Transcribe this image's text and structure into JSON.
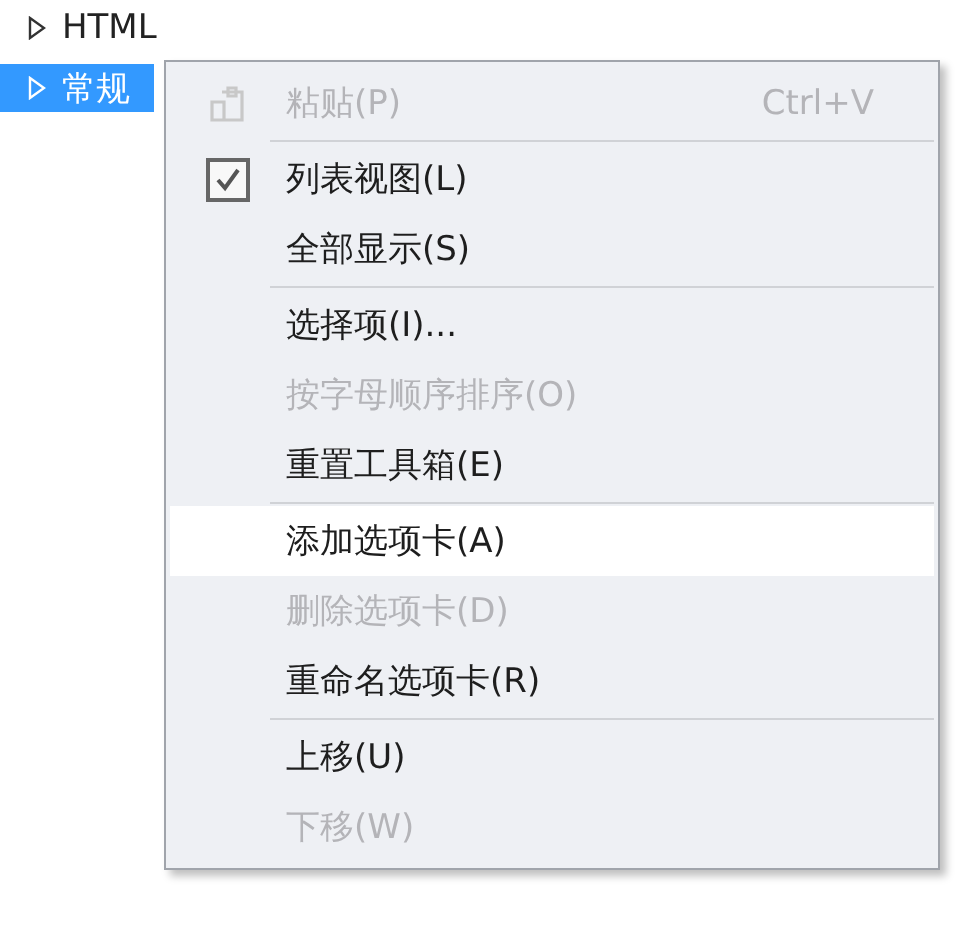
{
  "tree": [
    {
      "label": "HTML",
      "selected": false
    },
    {
      "label": "常规",
      "selected": true
    }
  ],
  "menu": [
    {
      "kind": "iconitem",
      "label": "粘贴(P)",
      "shortcut": "Ctrl+V",
      "disabled": true,
      "checked": false,
      "selected": false
    },
    {
      "kind": "separator"
    },
    {
      "kind": "item",
      "label": "列表视图(L)",
      "disabled": false,
      "checked": true,
      "selected": false
    },
    {
      "kind": "item",
      "label": "全部显示(S)",
      "disabled": false,
      "checked": false,
      "selected": false
    },
    {
      "kind": "separator"
    },
    {
      "kind": "item",
      "label": "选择项(I)...",
      "disabled": false,
      "checked": false,
      "selected": false
    },
    {
      "kind": "item",
      "label": "按字母顺序排序(O)",
      "disabled": true,
      "checked": false,
      "selected": false
    },
    {
      "kind": "item",
      "label": "重置工具箱(E)",
      "disabled": false,
      "checked": false,
      "selected": false
    },
    {
      "kind": "separator"
    },
    {
      "kind": "item",
      "label": "添加选项卡(A)",
      "disabled": false,
      "checked": false,
      "selected": true
    },
    {
      "kind": "item",
      "label": "删除选项卡(D)",
      "disabled": true,
      "checked": false,
      "selected": false
    },
    {
      "kind": "item",
      "label": "重命名选项卡(R)",
      "disabled": false,
      "checked": false,
      "selected": false
    },
    {
      "kind": "separator"
    },
    {
      "kind": "item",
      "label": "上移(U)",
      "disabled": false,
      "checked": false,
      "selected": false
    },
    {
      "kind": "item",
      "label": "下移(W)",
      "disabled": true,
      "checked": false,
      "selected": false
    }
  ]
}
